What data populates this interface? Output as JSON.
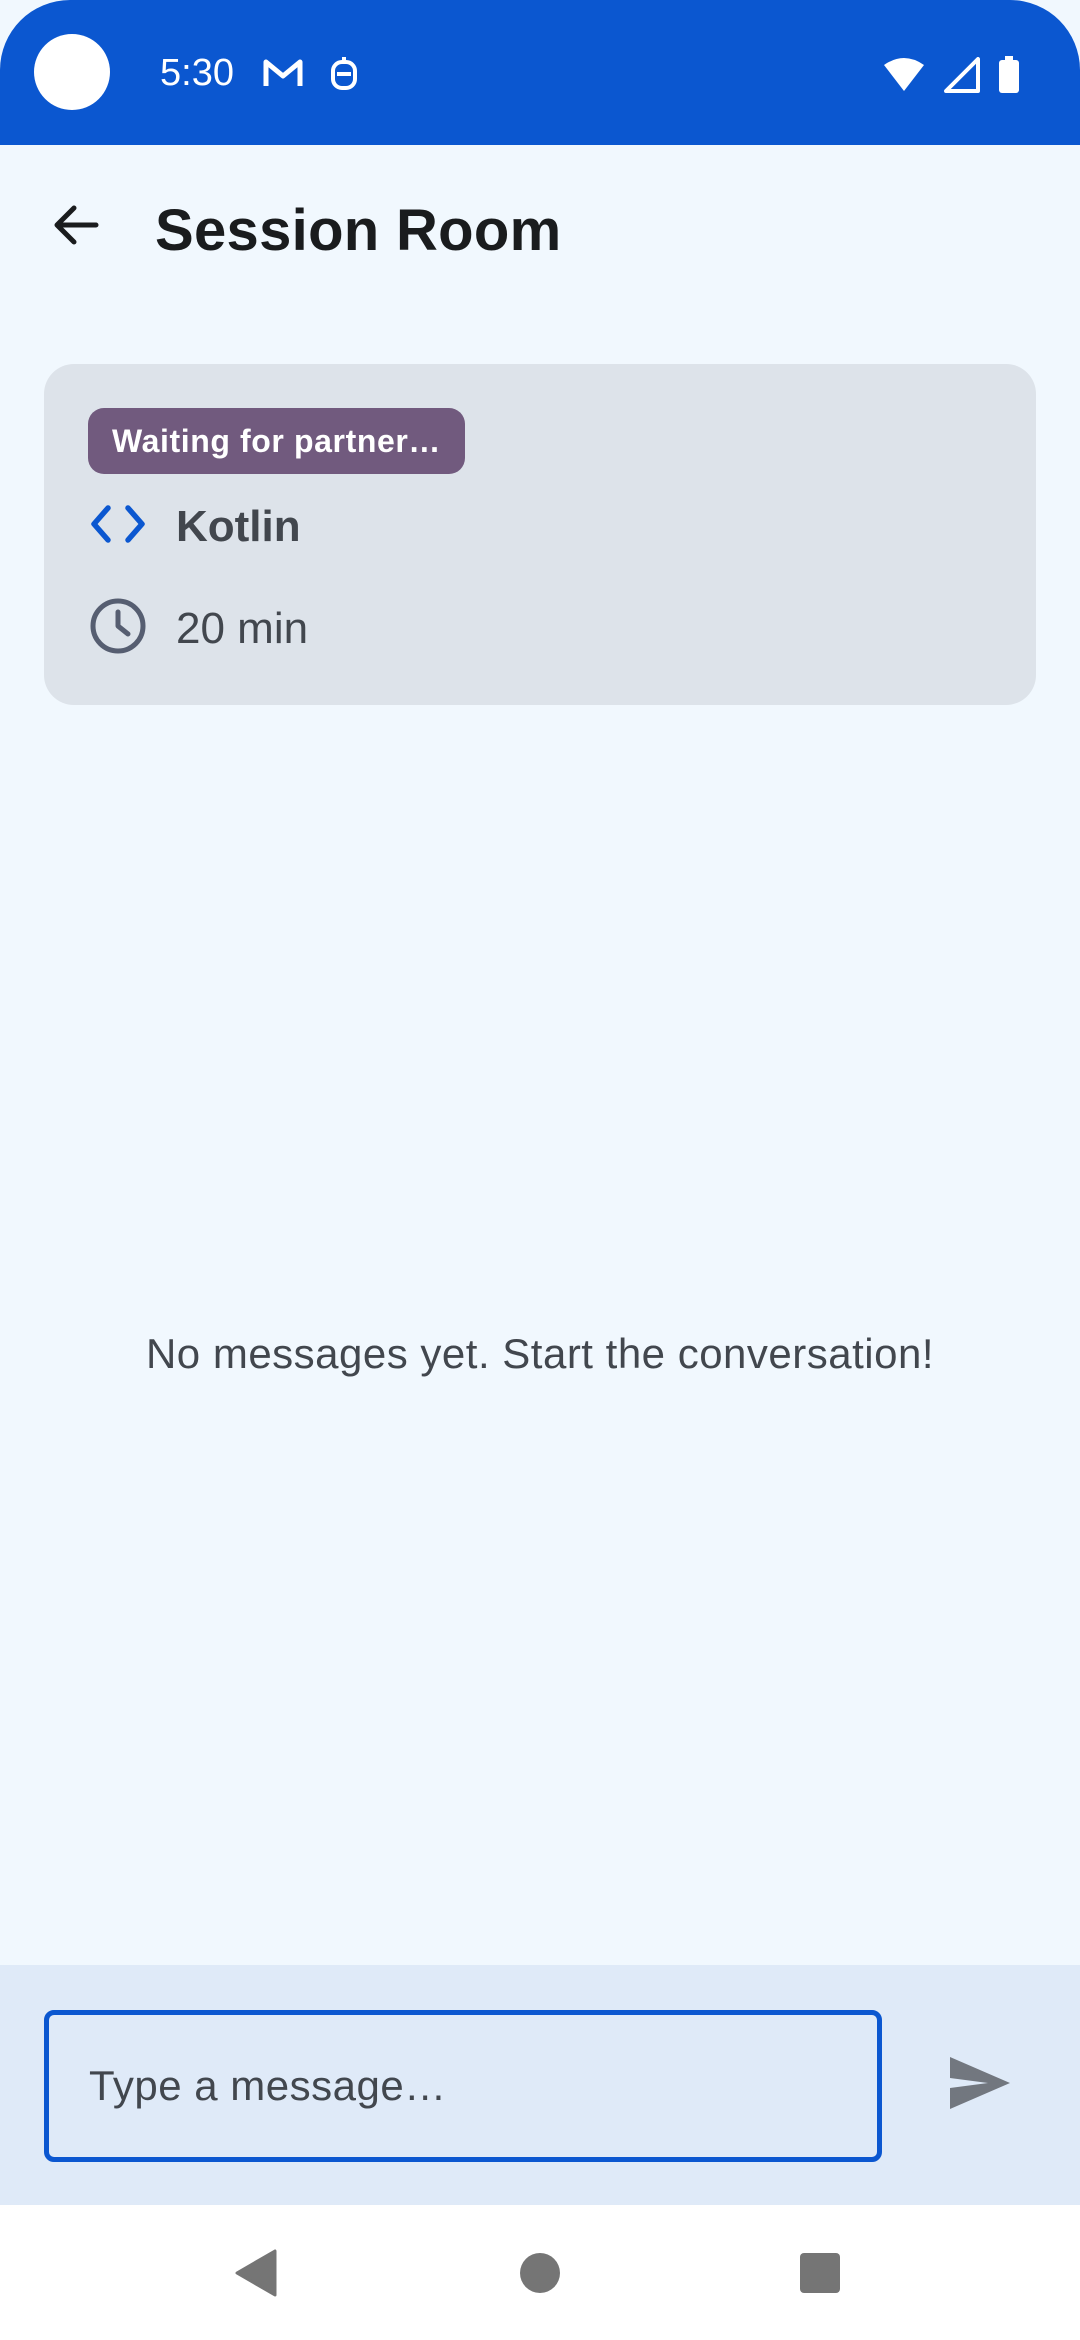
{
  "status_bar": {
    "time": "5:30",
    "icons_left": [
      "gmail-icon",
      "notification-icon"
    ],
    "icons_right": [
      "wifi-icon",
      "signal-icon",
      "battery-icon"
    ]
  },
  "app_bar": {
    "title": "Session Room",
    "back_icon": "arrow-back-icon"
  },
  "session": {
    "status_label": "Waiting for partner…",
    "language_icon": "code-icon",
    "language": "Kotlin",
    "duration_icon": "clock-icon",
    "duration": "20 min"
  },
  "chat": {
    "empty_message": "No messages yet. Start the conversation!"
  },
  "composer": {
    "placeholder": "Type a message…",
    "value": "",
    "send_icon": "send-icon"
  },
  "navigation": {
    "back_icon": "nav-back-icon",
    "home_icon": "nav-home-icon",
    "recents_icon": "nav-recents-icon"
  },
  "colors": {
    "primary": "#0b57d0",
    "background": "#f1f8fe",
    "card": "#dde3ea",
    "badge": "#715a7e",
    "composer_bg": "#dfeaf8"
  }
}
